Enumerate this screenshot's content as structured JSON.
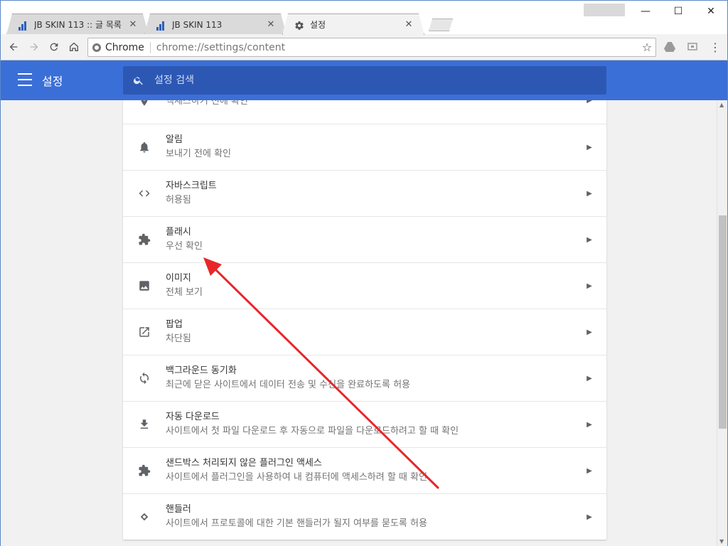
{
  "tabs": [
    {
      "label": "JB SKIN 113 :: 글 목록",
      "icon": "bar-chart-favicon-icon"
    },
    {
      "label": "JB SKIN 113",
      "icon": "bar-chart-favicon-icon"
    },
    {
      "label": "설정",
      "icon": "gear-icon",
      "active": true
    }
  ],
  "toolbar": {
    "site_label": "Chrome",
    "url": "chrome://settings/content"
  },
  "settings": {
    "title": "설정",
    "search_placeholder": "설정 검색"
  },
  "rows": [
    {
      "title": "",
      "subtitle": "액세스하기 전에 확인",
      "icon": "location-pin-icon"
    },
    {
      "title": "알림",
      "subtitle": "보내기 전에 확인",
      "icon": "bell-icon"
    },
    {
      "title": "자바스크립트",
      "subtitle": "허용됨",
      "icon": "code-icon"
    },
    {
      "title": "플래시",
      "subtitle": "우선 확인",
      "icon": "puzzle-icon"
    },
    {
      "title": "이미지",
      "subtitle": "전체 보기",
      "icon": "image-icon"
    },
    {
      "title": "팝업",
      "subtitle": "차단됨",
      "icon": "open-in-new-icon"
    },
    {
      "title": "백그라운드 동기화",
      "subtitle": "최근에 닫은 사이트에서 데이터 전송 및 수신을 완료하도록 허용",
      "icon": "sync-icon"
    },
    {
      "title": "자동 다운로드",
      "subtitle": "사이트에서 첫 파일 다운로드 후 자동으로 파일을 다운로드하려고 할 때 확인",
      "icon": "download-icon"
    },
    {
      "title": "샌드박스 처리되지 않은 플러그인 액세스",
      "subtitle": "사이트에서 플러그인을 사용하여 내 컴퓨터에 액세스하려 할 때 확인",
      "icon": "puzzle-icon"
    },
    {
      "title": "핸들러",
      "subtitle": "사이트에서 프로토콜에 대한 기본 핸들러가 될지 여부를 묻도록 허용",
      "icon": "handler-diamond-icon"
    }
  ],
  "colors": {
    "header_blue": "#3b6fd8",
    "search_blue": "#2c58b4",
    "annotation_red": "#e8262a"
  }
}
